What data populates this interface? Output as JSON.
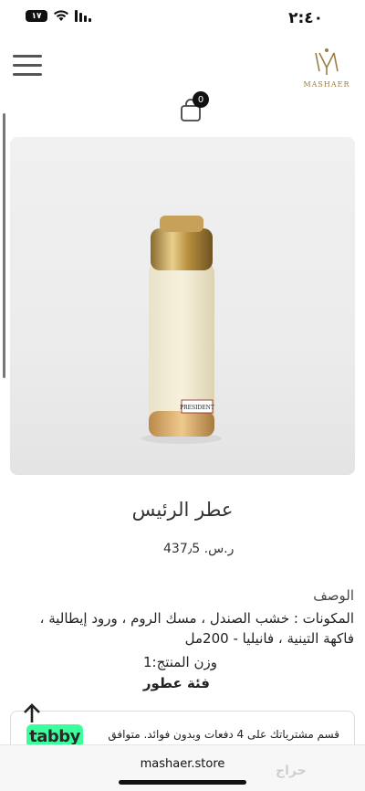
{
  "status": {
    "time": "٢:٤٠",
    "battery": "١٧"
  },
  "header": {
    "logo_text": "MASHAER",
    "cart_count": "0"
  },
  "product": {
    "title": "عطر الرئيس",
    "bottle_label": "PRESIDENT",
    "price": "437٫5",
    "currency": "ر.س."
  },
  "description": {
    "label": "الوصف",
    "ingredients": "المكونات : خشب الصندل ، مسك الروم ، ورود إيطالية ، فاكهة التينية ، فانيليا - 200مل",
    "weight": "وزن المنتج:1",
    "category": "فئة عطور"
  },
  "tabby": {
    "logo": "tabby",
    "text": "قسم مشترياتك على 4 دفعات وبدون فوائد. متوافق"
  },
  "browser": {
    "url": "mashaer.store"
  },
  "watermark": "حراج",
  "colors": {
    "tabby_green": "#3bff9d",
    "brand_gold": "#9a7c45"
  }
}
